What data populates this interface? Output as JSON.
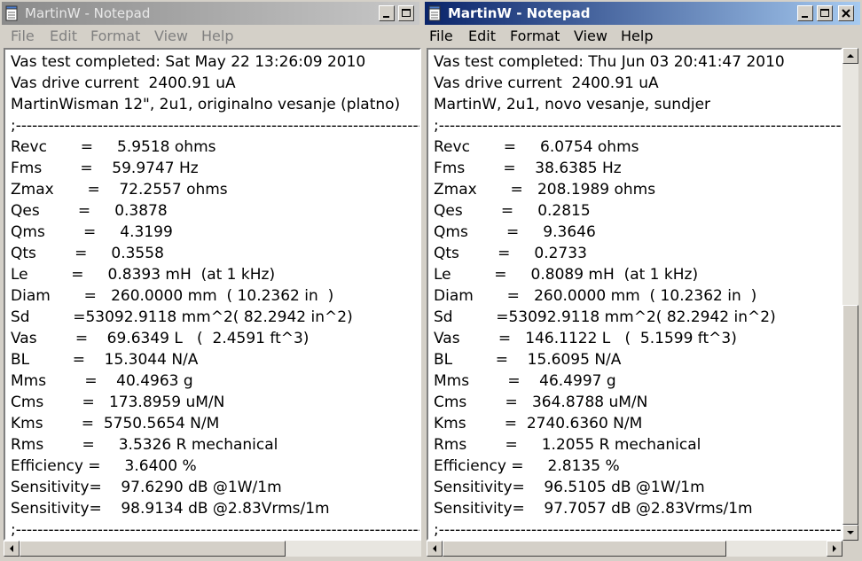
{
  "windows": [
    {
      "title": "MartinW - Notepad",
      "active": false,
      "menu": [
        "File",
        "Edit",
        "Format",
        "View",
        "Help"
      ],
      "lines": [
        "Vas test completed: Sat May 22 13:26:09 2010",
        "Vas drive current  2400.91 uA",
        "MartinWisman 12\", 2u1, originalno vesanje (platno)",
        ";---------------------------------------------------------------------------------------------",
        "Revc       =     5.9518 ohms",
        "Fms        =    59.9747 Hz",
        "Zmax       =    72.2557 ohms",
        "Qes        =     0.3878",
        "Qms        =     4.3199",
        "Qts        =     0.3558",
        "Le         =     0.8393 mH  (at 1 kHz)",
        "Diam       =   260.0000 mm  ( 10.2362 in  )",
        "Sd         =53092.9118 mm^2( 82.2942 in^2)",
        "Vas        =    69.6349 L   (  2.4591 ft^3)",
        "BL         =    15.3044 N/A",
        "Mms        =    40.4963 g",
        "Cms        =   173.8959 uM/N",
        "Kms        =  5750.5654 N/M",
        "Rms        =     3.5326 R mechanical",
        "Efficiency =     3.6400 %",
        "Sensitivity=    97.6290 dB @1W/1m",
        "Sensitivity=    98.9134 dB @2.83Vrms/1m",
        ";---------------------------------------------------------------------------------------------"
      ]
    },
    {
      "title": "MartinW - Notepad",
      "active": true,
      "menu": [
        "File",
        "Edit",
        "Format",
        "View",
        "Help"
      ],
      "lines": [
        "Vas test completed: Thu Jun 03 20:41:47 2010",
        "Vas drive current  2400.91 uA",
        "MartinW, 2u1, novo vesanje, sundjer",
        ";---------------------------------------------------------------------------------------------",
        "Revc       =     6.0754 ohms",
        "Fms        =    38.6385 Hz",
        "Zmax       =   208.1989 ohms",
        "Qes        =     0.2815",
        "Qms        =     9.3646",
        "Qts        =     0.2733",
        "Le         =     0.8089 mH  (at 1 kHz)",
        "Diam       =   260.0000 mm  ( 10.2362 in  )",
        "Sd         =53092.9118 mm^2( 82.2942 in^2)",
        "Vas        =   146.1122 L   (  5.1599 ft^3)",
        "BL         =    15.6095 N/A",
        "Mms        =    46.4997 g",
        "Cms        =   364.8788 uM/N",
        "Kms        =  2740.6360 N/M",
        "Rms        =     1.2055 R mechanical",
        "Efficiency =     2.8135 %",
        "Sensitivity=    96.5105 dB @1W/1m",
        "Sensitivity=    97.7057 dB @2.83Vrms/1m",
        ";---------------------------------------------------------------------------------------------"
      ]
    }
  ],
  "colors": {
    "active_title_start": "#0a246a",
    "active_title_end": "#a6caf0",
    "inactive_title_start": "#8a8a8a",
    "inactive_title_end": "#c8c8c8",
    "chrome": "#d4d0c8"
  },
  "icons": [
    "notepad-icon",
    "minimize-icon",
    "maximize-icon",
    "close-icon",
    "arrow-up-icon",
    "arrow-down-icon",
    "arrow-left-icon",
    "arrow-right-icon"
  ]
}
